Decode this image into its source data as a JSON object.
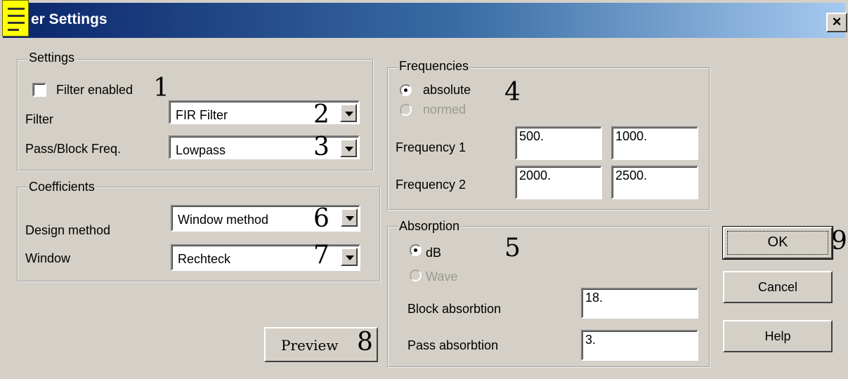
{
  "window": {
    "title": "er Settings",
    "close_symbol": "×",
    "menu_icon": "hamburger-icon"
  },
  "settings": {
    "legend": "Settings",
    "filter_enabled_label": "Filter enabled",
    "filter_enabled_checked": false,
    "filter_label": "Filter",
    "filter_value": "FIR Filter",
    "passblock_label": "Pass/Block Freq.",
    "passblock_value": "Lowpass"
  },
  "coefficients": {
    "legend": "Coefficients",
    "design_label": "Design method",
    "design_value": "Window method",
    "window_label": "Window",
    "window_value": "Rechteck"
  },
  "frequencies": {
    "legend": "Frequencies",
    "absolute_label": "absolute",
    "normed_label": "normed",
    "freq1_label": "Frequency 1",
    "freq1_a": "500.",
    "freq1_b": "1000.",
    "freq2_label": "Frequency 2",
    "freq2_a": "2000.",
    "freq2_b": "2500."
  },
  "absorption": {
    "legend": "Absorption",
    "db_label": "dB",
    "wave_label": "Wave",
    "block_label": "Block absorbtion",
    "block_value": "18.",
    "pass_label": "Pass absorbtion",
    "pass_value": "3."
  },
  "buttons": {
    "preview": "Preview",
    "ok": "OK",
    "cancel": "Cancel",
    "help": "Help"
  },
  "annotations": [
    "1",
    "2",
    "3",
    "4",
    "5",
    "6",
    "7",
    "8",
    "9"
  ]
}
